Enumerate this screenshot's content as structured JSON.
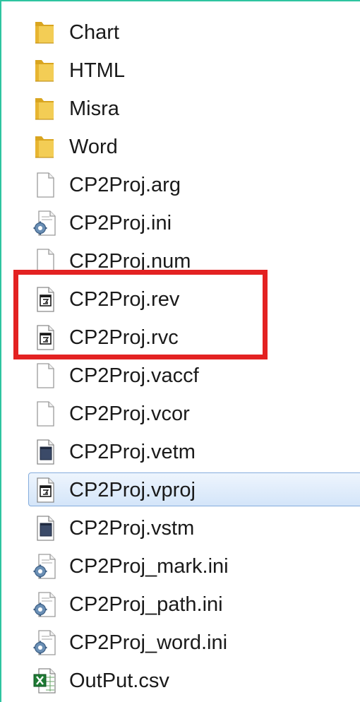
{
  "files": [
    {
      "name": "Chart",
      "icon": "folder-icon",
      "kind": "folder"
    },
    {
      "name": "HTML",
      "icon": "folder-icon",
      "kind": "folder"
    },
    {
      "name": "Misra",
      "icon": "folder-icon",
      "kind": "folder"
    },
    {
      "name": "Word",
      "icon": "folder-icon",
      "kind": "folder"
    },
    {
      "name": "CP2Proj.arg",
      "icon": "blank-file-icon",
      "kind": "blank"
    },
    {
      "name": "CP2Proj.ini",
      "icon": "settings-file-icon",
      "kind": "settings"
    },
    {
      "name": "CP2Proj.num",
      "icon": "blank-file-icon",
      "kind": "blank"
    },
    {
      "name": "CP2Proj.rev",
      "icon": "app-file-icon",
      "kind": "app"
    },
    {
      "name": "CP2Proj.rvc",
      "icon": "app-file-icon",
      "kind": "app"
    },
    {
      "name": "CP2Proj.vaccf",
      "icon": "blank-file-icon",
      "kind": "blank"
    },
    {
      "name": "CP2Proj.vcor",
      "icon": "blank-file-icon",
      "kind": "blank"
    },
    {
      "name": "CP2Proj.vetm",
      "icon": "dark-file-icon",
      "kind": "dark"
    },
    {
      "name": "CP2Proj.vproj",
      "icon": "app-file-icon",
      "kind": "app",
      "selected": true
    },
    {
      "name": "CP2Proj.vstm",
      "icon": "dark-file-icon",
      "kind": "dark"
    },
    {
      "name": "CP2Proj_mark.ini",
      "icon": "settings-file-icon",
      "kind": "settings"
    },
    {
      "name": "CP2Proj_path.ini",
      "icon": "settings-file-icon",
      "kind": "settings"
    },
    {
      "name": "CP2Proj_word.ini",
      "icon": "settings-file-icon",
      "kind": "settings"
    },
    {
      "name": "OutPut.csv",
      "icon": "excel-file-icon",
      "kind": "excel"
    }
  ],
  "colors": {
    "highlight": "#e32222",
    "selection_border": "#84acdd",
    "frame_accent": "#2ec4a0"
  }
}
